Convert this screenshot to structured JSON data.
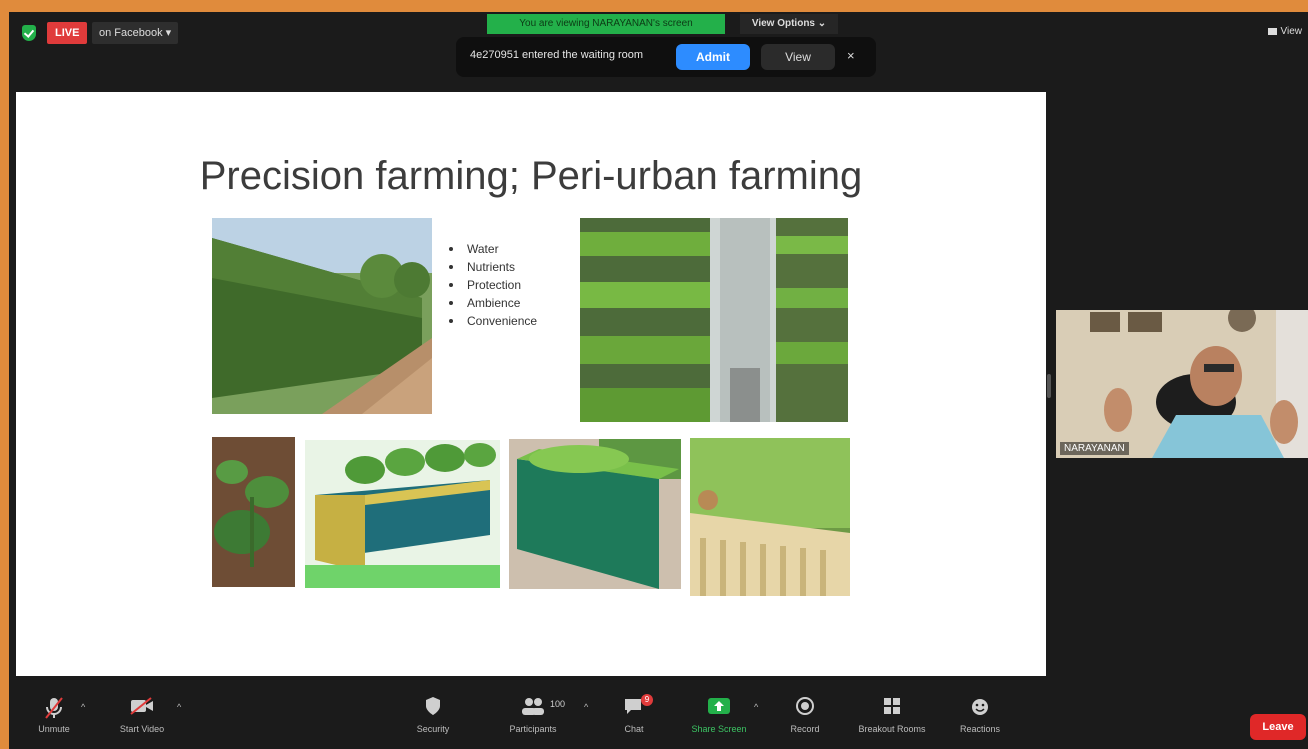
{
  "topbar": {
    "live_label": "LIVE",
    "stream_target": "on Facebook ▾",
    "viewing_banner": "You are viewing NARAYANAN's screen",
    "view_options": "View Options ⌄",
    "view_label": "View"
  },
  "notification": {
    "text": "4e270951 entered the waiting room",
    "admit_label": "Admit",
    "view_label": "View",
    "close_glyph": "×"
  },
  "slide": {
    "title": "Precision farming; Peri-urban farming",
    "bullets": [
      "Water",
      "Nutrients",
      "Protection",
      "Ambience",
      "Convenience"
    ]
  },
  "participant": {
    "name": "NARAYANAN"
  },
  "toolbar": {
    "unmute": "Unmute",
    "start_video": "Start Video",
    "security": "Security",
    "participants": "Participants",
    "participant_count": "100",
    "chat": "Chat",
    "chat_badge": "9",
    "share_screen": "Share Screen",
    "record": "Record",
    "breakout_rooms": "Breakout Rooms",
    "reactions": "Reactions",
    "leave": "Leave"
  },
  "colors": {
    "accent_blue": "#2d8cff",
    "live_red": "#e03b3b",
    "share_green": "#23b04a",
    "frame_orange": "#e08b3c"
  }
}
